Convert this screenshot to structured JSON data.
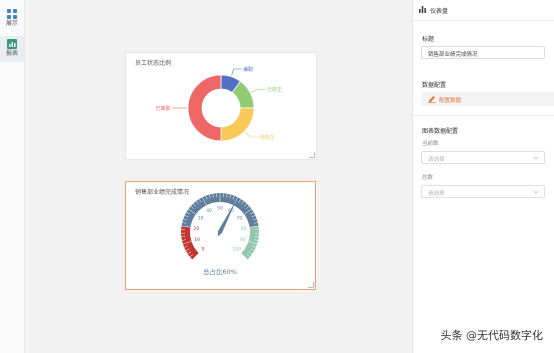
{
  "left_rail": {
    "items": [
      {
        "label": "展示",
        "icon": "grid-icon"
      },
      {
        "label": "报表",
        "icon": "report-icon"
      }
    ]
  },
  "pie_card": {
    "title": "员工状态比例",
    "slices": [
      {
        "name": "兼职",
        "value": 10,
        "color": "#5470c6"
      },
      {
        "name": "已转正",
        "value": 15,
        "color": "#91cc75"
      },
      {
        "name": "待转正",
        "value": 25,
        "color": "#fac858"
      },
      {
        "name": "已离职",
        "value": 50,
        "color": "#ee6666"
      }
    ]
  },
  "gauge_card": {
    "title": "销售部业绩完成情况",
    "ticks": [
      "0",
      "10",
      "20",
      "30",
      "40",
      "50",
      "60",
      "70",
      "80",
      "90",
      "100"
    ],
    "detail": "总占比60%",
    "value": 60
  },
  "chart_data": [
    {
      "type": "pie",
      "title": "员工状态比例",
      "categories": [
        "兼职",
        "已转正",
        "待转正",
        "已离职"
      ],
      "values": [
        10,
        15,
        25,
        50
      ]
    },
    {
      "type": "gauge",
      "title": "销售部业绩完成情况",
      "value": 60,
      "range": [
        0,
        100
      ],
      "detail": "总占比60%"
    }
  ],
  "panel": {
    "header": "仪表盘",
    "title_label": "标题",
    "title_value": "销售部业绩完成情况",
    "data_config_label": "数据配置",
    "config_data_button": "配置数据",
    "chart_data_config_label": "图表数据配置",
    "current_label": "当前数",
    "current_placeholder": "请选择",
    "total_label": "总数",
    "total_placeholder": "请选择"
  },
  "watermark": "头条 @无代码数字化",
  "colors": {
    "accent": "#e8743b",
    "gauge_dark": "#5f7f9c",
    "gauge_red": "#c23531",
    "gauge_green": "#91c7ae"
  }
}
